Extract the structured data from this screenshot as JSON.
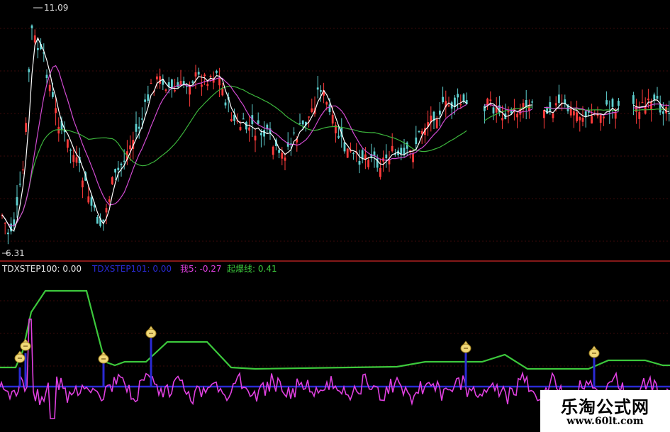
{
  "chart_data": [
    {
      "type": "candlestick",
      "price_high_label": "11.09",
      "price_low_label": "6.31",
      "ylim": [
        6.31,
        11.09
      ],
      "colors": {
        "up": "#ff3b3b",
        "down": "#5fd0d0",
        "ma_fast": "#ffffff",
        "ma_mid": "#d24bd2",
        "ma_slow": "#3cb43c"
      }
    },
    {
      "type": "line",
      "legend": [
        {
          "name": "TDXSTEP100",
          "value": "0.00",
          "color": "#e8e8e8"
        },
        {
          "name": "TDXSTEP101",
          "value": "0.00",
          "color": "#2a2ad4"
        },
        {
          "name": "我5",
          "value": "-0.27",
          "color": "#e040e0"
        },
        {
          "name": "起爆线",
          "value": "0.41",
          "color": "#3cc83c"
        }
      ],
      "colors": {
        "step100": "#e8e8e8",
        "step101": "#2a2ad4",
        "wo5": "#e040e0",
        "qibao": "#3cc83c"
      }
    }
  ],
  "watermark": {
    "title": "乐淘公式网",
    "url": "www.60lt.com"
  }
}
